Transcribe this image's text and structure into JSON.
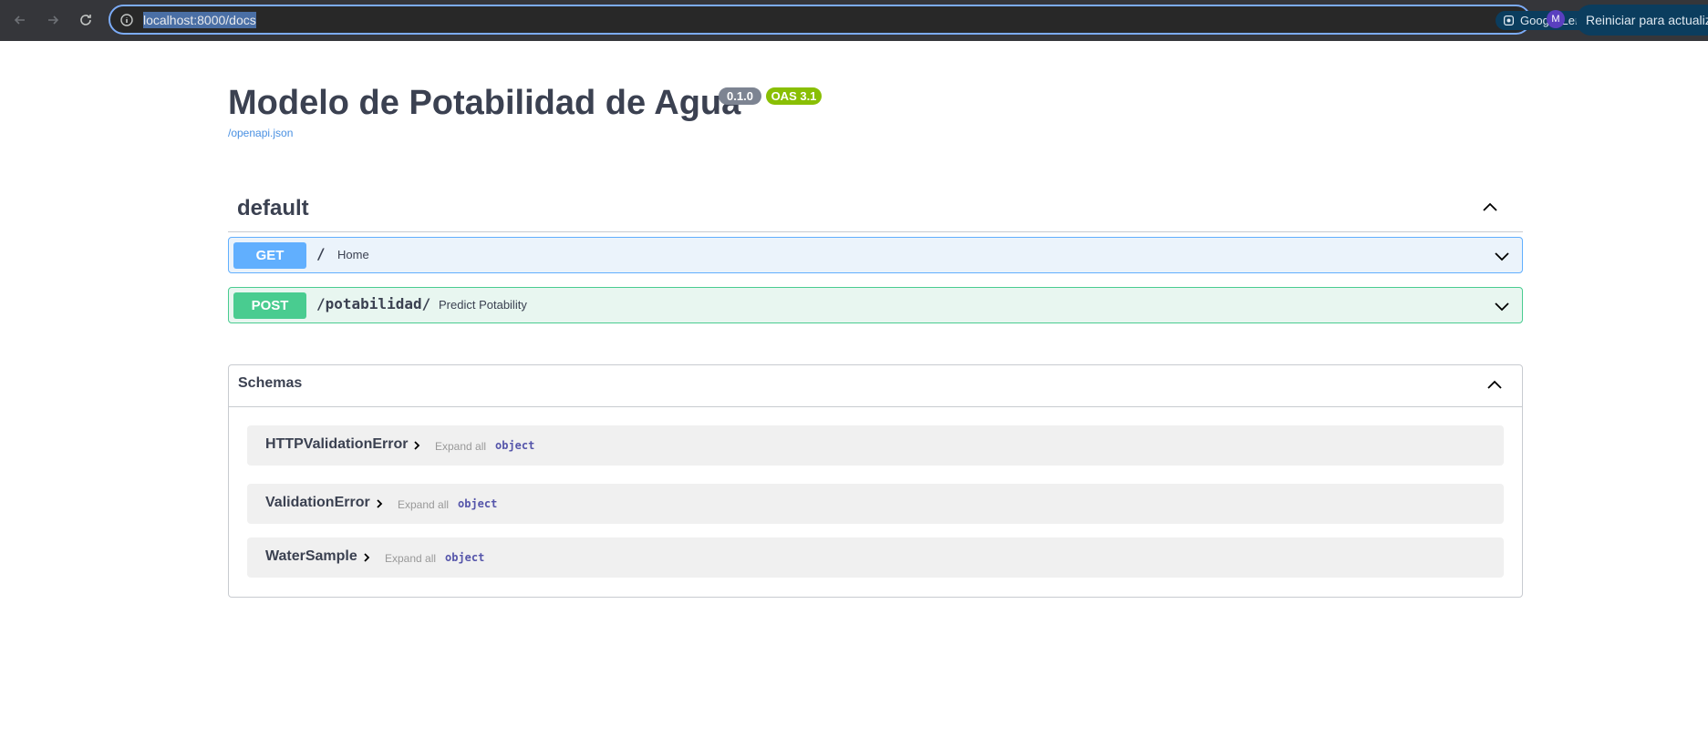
{
  "browser": {
    "url": "localhost:8000/docs",
    "lens_label": "Google Lens",
    "avatar_initial": "M",
    "relaunch_label": "Reiniciar para actualizar"
  },
  "api": {
    "title": "Modelo de Potabilidad de Agua",
    "version": "0.1.0",
    "oas": "OAS 3.1",
    "spec_link": "/openapi.json"
  },
  "tag": {
    "name": "default"
  },
  "operations": [
    {
      "method": "GET",
      "path": "/",
      "summary": "Home",
      "color": "#61affe"
    },
    {
      "method": "POST",
      "path": "/potabilidad/",
      "summary": "Predict Potability",
      "color": "#49cc90"
    }
  ],
  "schemas": {
    "title": "Schemas",
    "models": [
      {
        "name": "HTTPValidationError",
        "expand_label": "Expand all",
        "type": "object"
      },
      {
        "name": "ValidationError",
        "expand_label": "Expand all",
        "type": "object"
      },
      {
        "name": "WaterSample",
        "expand_label": "Expand all",
        "type": "object"
      }
    ]
  },
  "icons": {
    "back": "arrow-left-icon",
    "forward": "arrow-right-icon",
    "reload": "reload-icon",
    "site_info": "info-icon",
    "bookmark": "star-icon",
    "collapse": "chevron-up-icon",
    "expand": "chevron-down-icon",
    "model_expand": "chevron-right-icon"
  }
}
